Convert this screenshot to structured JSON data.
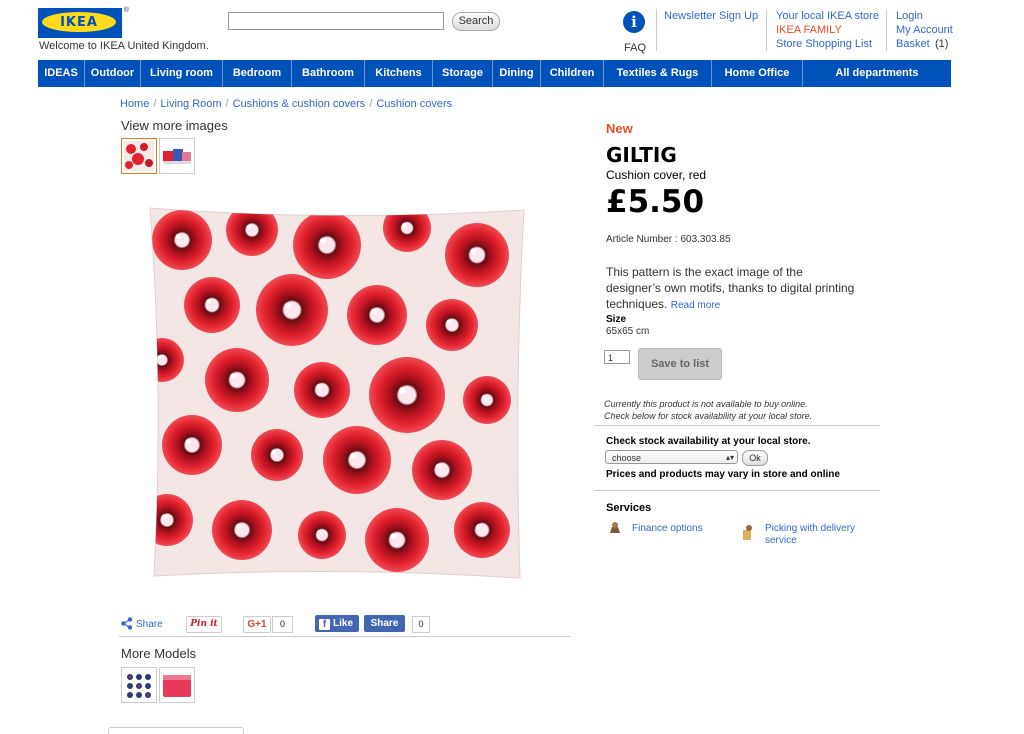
{
  "header": {
    "logo_text": "IKEA",
    "welcome": "Welcome to IKEA United Kingdom.",
    "search_button": "Search",
    "faq": "FAQ",
    "newsletter": "Newsletter Sign Up",
    "local_store": "Your local IKEA store",
    "ikea_family": "IKEA FAMILY",
    "store_shopping_list": "Store Shopping List",
    "login": "Login",
    "my_account": "My Account",
    "basket": "Basket",
    "basket_count": "(1)"
  },
  "nav": [
    {
      "label": "IDEAS"
    },
    {
      "label": "Outdoor"
    },
    {
      "label": "Living room"
    },
    {
      "label": "Bedroom"
    },
    {
      "label": "Bathroom"
    },
    {
      "label": "Kitchens"
    },
    {
      "label": "Storage"
    },
    {
      "label": "Dining"
    },
    {
      "label": "Children"
    },
    {
      "label": "Textiles & Rugs"
    },
    {
      "label": "Home Office"
    },
    {
      "label": "All departments"
    }
  ],
  "breadcrumb": [
    "Home",
    "Living Room",
    "Cushions & cushion covers",
    "Cushion covers"
  ],
  "gallery": {
    "title": "View more images"
  },
  "product": {
    "badge": "New",
    "name": "GILTIG",
    "type": "Cushion cover, red",
    "price": "£5.50",
    "article": "Article Number : 603.303.85",
    "description": "This pattern is the exact image of the designer’s own motifs, thanks to digital printing techniques.",
    "read_more": "Read more",
    "size_label": "Size",
    "size_value": "65x65 cm",
    "quantity": "1",
    "save_button": "Save to list",
    "not_available_1": "Currently this product is not available to buy online.",
    "not_available_2": "Check below for stock availability at your local store."
  },
  "stock": {
    "title": "Check stock availability at your local store.",
    "select_value": "choose",
    "ok_button": "Ok",
    "note": "Prices and products may vary in store and online"
  },
  "services": {
    "title": "Services",
    "finance": "Finance options",
    "picking_1": "Picking with delivery",
    "picking_2": "service"
  },
  "social": {
    "share": "Share",
    "pinit": "Pin it",
    "gplus": "G+1",
    "gplus_count": "0",
    "fb_like": "Like",
    "fb_share": "Share",
    "fb_count": "0"
  },
  "more_models": {
    "title": "More Models"
  },
  "colors": {
    "nav_bg": "#0051ba",
    "link": "#3366cc",
    "accent": "#e94e24",
    "logo_yellow": "#ffda1a"
  }
}
